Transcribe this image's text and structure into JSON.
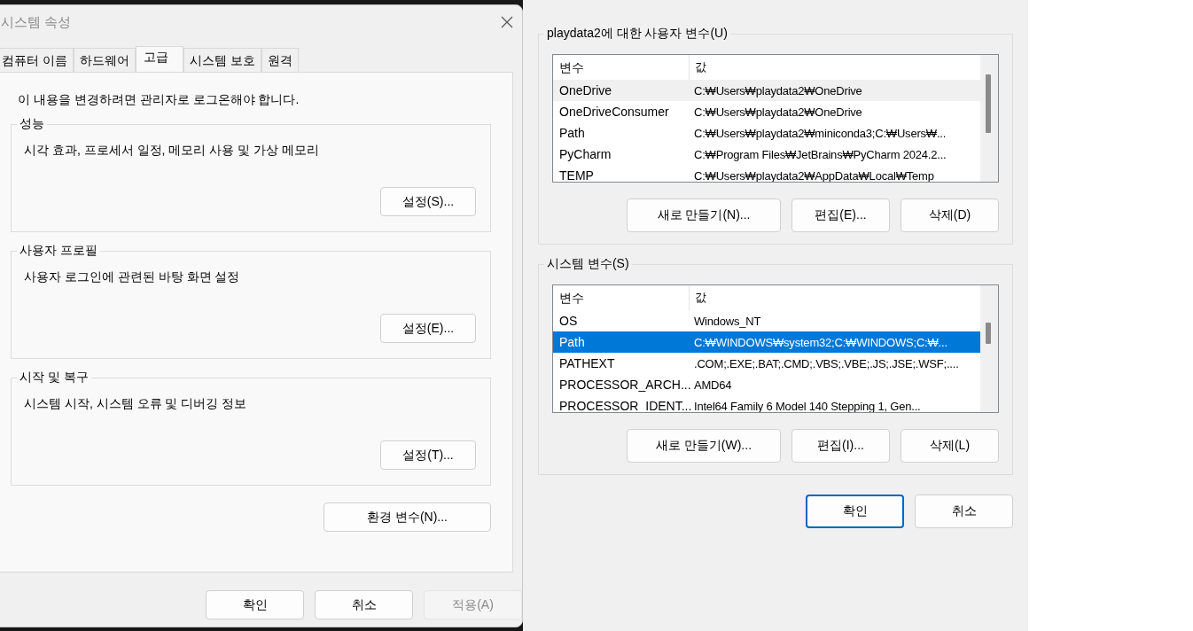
{
  "system_properties": {
    "title": "시스템 속성",
    "tabs": [
      {
        "label": "컴퓨터 이름",
        "selected": false
      },
      {
        "label": "하드웨어",
        "selected": false
      },
      {
        "label": "고급",
        "selected": true
      },
      {
        "label": "시스템 보호",
        "selected": false
      },
      {
        "label": "원격",
        "selected": false
      }
    ],
    "notice": "이 내용을 변경하려면 관리자로 로그온해야 합니다.",
    "groups": [
      {
        "title": "성능",
        "description": "시각 효과, 프로세서 일정, 메모리 사용 및 가상 메모리",
        "button": "설정(S)..."
      },
      {
        "title": "사용자 프로필",
        "description": "사용자 로그인에 관련된 바탕 화면 설정",
        "button": "설정(E)..."
      },
      {
        "title": "시작 및 복구",
        "description": "시스템 시작, 시스템 오류 및 디버깅 정보",
        "button": "설정(T)..."
      }
    ],
    "env_button": "환경 변수(N)...",
    "buttons": [
      {
        "label": "확인",
        "disabled": false
      },
      {
        "label": "취소",
        "disabled": false
      },
      {
        "label": "적용(A)",
        "disabled": true
      }
    ]
  },
  "environment_variables": {
    "sections": [
      {
        "title": "playdata2에 대한 사용자 변수(U)",
        "columns": [
          "변수",
          "값"
        ],
        "rows": [
          {
            "name": "OneDrive",
            "value": "C:₩Users₩playdata2₩OneDrive",
            "selected": false,
            "hovered": true
          },
          {
            "name": "OneDriveConsumer",
            "value": "C:₩Users₩playdata2₩OneDrive",
            "selected": false,
            "hovered": false
          },
          {
            "name": "Path",
            "value": "C:₩Users₩playdata2₩miniconda3;C:₩Users₩...",
            "selected": false,
            "hovered": false
          },
          {
            "name": "PyCharm",
            "value": "C:₩Program Files₩JetBrains₩PyCharm 2024.2...",
            "selected": false,
            "hovered": false
          },
          {
            "name": "TEMP",
            "value": "C:₩Users₩playdata2₩AppData₩Local₩Temp",
            "selected": false,
            "hovered": false
          }
        ],
        "buttons": [
          "새로 만들기(N)...",
          "편집(E)...",
          "삭제(D)"
        ]
      },
      {
        "title": "시스템 변수(S)",
        "columns": [
          "변수",
          "값"
        ],
        "rows": [
          {
            "name": "OS",
            "value": "Windows_NT",
            "selected": false,
            "hovered": false
          },
          {
            "name": "Path",
            "value": "C:₩WINDOWS₩system32;C:₩WINDOWS;C:₩...",
            "selected": true,
            "hovered": false
          },
          {
            "name": "PATHEXT",
            "value": ".COM;.EXE;.BAT;.CMD;.VBS;.VBE;.JS;.JSE;.WSF;....",
            "selected": false,
            "hovered": false
          },
          {
            "name": "PROCESSOR_ARCH...",
            "value": "AMD64",
            "selected": false,
            "hovered": false
          },
          {
            "name": "PROCESSOR_IDENT...",
            "value": "Intel64 Family 6 Model 140 Stepping 1, Gen...",
            "selected": false,
            "hovered": false
          }
        ],
        "buttons": [
          "새로 만들기(W)...",
          "편집(I)...",
          "삭제(L)"
        ]
      }
    ],
    "buttons": [
      {
        "label": "확인",
        "default": true
      },
      {
        "label": "취소",
        "default": false
      }
    ]
  }
}
